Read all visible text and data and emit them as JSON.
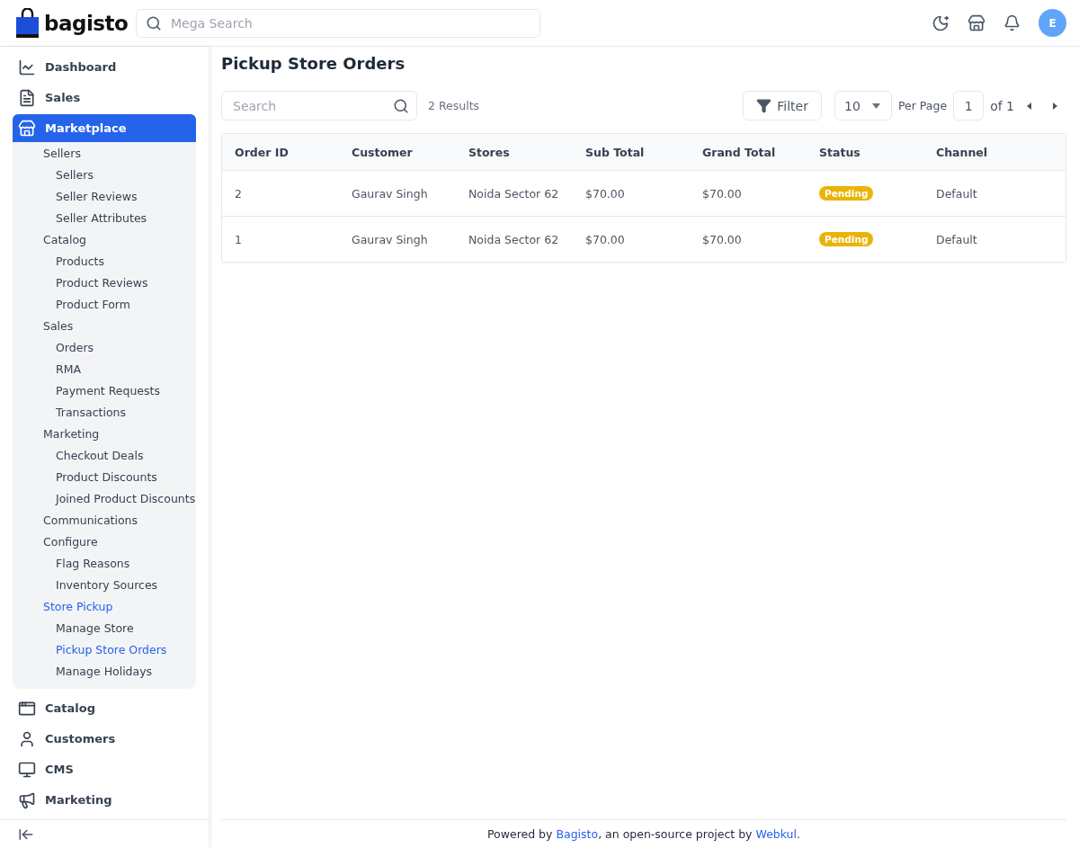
{
  "header": {
    "logo": "bagisto",
    "search": {
      "placeholder": "Mega Search"
    },
    "avatar": "E"
  },
  "sidebar": {
    "items": [
      {
        "label": "Dashboard",
        "selected": false,
        "expanded": false
      },
      {
        "label": "Sales",
        "selected": false,
        "expanded": false
      },
      {
        "label": "Marketplace",
        "selected": true,
        "expanded": true,
        "children": [
          {
            "label": "Sellers",
            "selected": false,
            "children": [
              {
                "label": "Sellers",
                "selected": false
              },
              {
                "label": "Seller Reviews",
                "selected": false
              },
              {
                "label": "Seller Attributes",
                "selected": false
              }
            ]
          },
          {
            "label": "Catalog",
            "selected": false,
            "children": [
              {
                "label": "Products",
                "selected": false
              },
              {
                "label": "Product Reviews",
                "selected": false
              },
              {
                "label": "Product Form",
                "selected": false
              }
            ]
          },
          {
            "label": "Sales",
            "selected": false,
            "children": [
              {
                "label": "Orders",
                "selected": false
              },
              {
                "label": "RMA",
                "selected": false
              },
              {
                "label": "Payment Requests",
                "selected": false
              },
              {
                "label": "Transactions",
                "selected": false
              }
            ]
          },
          {
            "label": "Marketing",
            "selected": false,
            "children": [
              {
                "label": "Checkout Deals",
                "selected": false
              },
              {
                "label": "Product Discounts",
                "selected": false
              },
              {
                "label": "Joined Product Discounts",
                "selected": false
              }
            ]
          },
          {
            "label": "Communications",
            "selected": false
          },
          {
            "label": "Configure",
            "selected": false,
            "children": [
              {
                "label": "Flag Reasons",
                "selected": false
              },
              {
                "label": "Inventory Sources",
                "selected": false
              }
            ]
          },
          {
            "label": "Store Pickup",
            "selected": true,
            "children": [
              {
                "label": "Manage Store",
                "selected": false
              },
              {
                "label": "Pickup Store Orders",
                "selected": true
              },
              {
                "label": "Manage Holidays",
                "selected": false
              }
            ]
          }
        ]
      },
      {
        "label": "Catalog",
        "selected": false,
        "expanded": false
      },
      {
        "label": "Customers",
        "selected": false,
        "expanded": false
      },
      {
        "label": "CMS",
        "selected": false,
        "expanded": false
      },
      {
        "label": "Marketing",
        "selected": false,
        "expanded": false
      }
    ]
  },
  "page": {
    "title": "Pickup Store Orders"
  },
  "toolbar": {
    "search": {
      "placeholder": "Search"
    },
    "results": "2 Results",
    "filter": "Filter",
    "per_page_value": "10",
    "per_page_label": "Per Page",
    "page": "1",
    "page_count": "of 1"
  },
  "table": {
    "columns": [
      "Order ID",
      "Customer",
      "Stores",
      "Sub Total",
      "Grand Total",
      "Status",
      "Channel"
    ],
    "rows": [
      {
        "cells": [
          "2",
          "Gaurav Singh",
          "Noida Sector 62",
          "$70.00",
          "$70.00",
          "Pending",
          "Default"
        ]
      },
      {
        "cells": [
          "1",
          "Gaurav Singh",
          "Noida Sector 62",
          "$70.00",
          "$70.00",
          "Pending",
          "Default"
        ]
      }
    ]
  },
  "footer": {
    "before": "Powered by ",
    "link1": "Bagisto",
    "middle": ", an open-source project by ",
    "link2": "Webkul",
    "after": "."
  }
}
